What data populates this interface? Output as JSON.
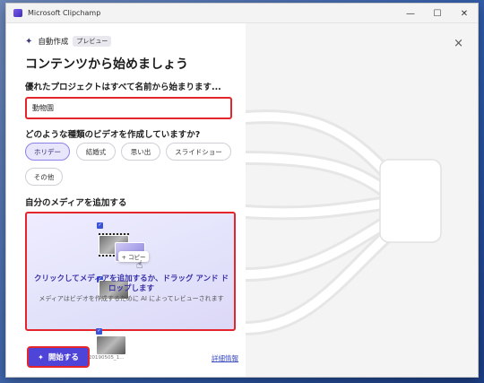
{
  "window": {
    "title": "Microsoft Clipchamp",
    "minimize": "—",
    "maximize": "☐",
    "close": "✕"
  },
  "panel": {
    "auto_label": "自動作成",
    "preview_badge": "プレビュー",
    "headline": "コンテンツから始めましょう",
    "name_question": "優れたプロジェクトはすべて名前から始まります...",
    "name_value": "動物園",
    "type_question": "どのような種類のビデオを作成していますか?",
    "types": [
      "ホリデー",
      "結婚式",
      "思い出",
      "スライドショー",
      "その他"
    ],
    "selected_type": "ホリデー",
    "media_heading": "自分のメディアを追加する",
    "dropzone": {
      "copy_label": "+ コピー",
      "title": "クリックしてメディアを追加するか、ドラッグ アンド ドロップします",
      "subtitle": "メディアはビデオを作成するために AI によってレビューされます",
      "file_name": "20190505_1..."
    },
    "start_button": "開始する",
    "details_link": "詳細情報"
  },
  "right_close": "×",
  "colors": {
    "accent": "#4f44d8",
    "highlight_border": "#e5252c",
    "dropzone_bg": "#e8e6fb"
  }
}
